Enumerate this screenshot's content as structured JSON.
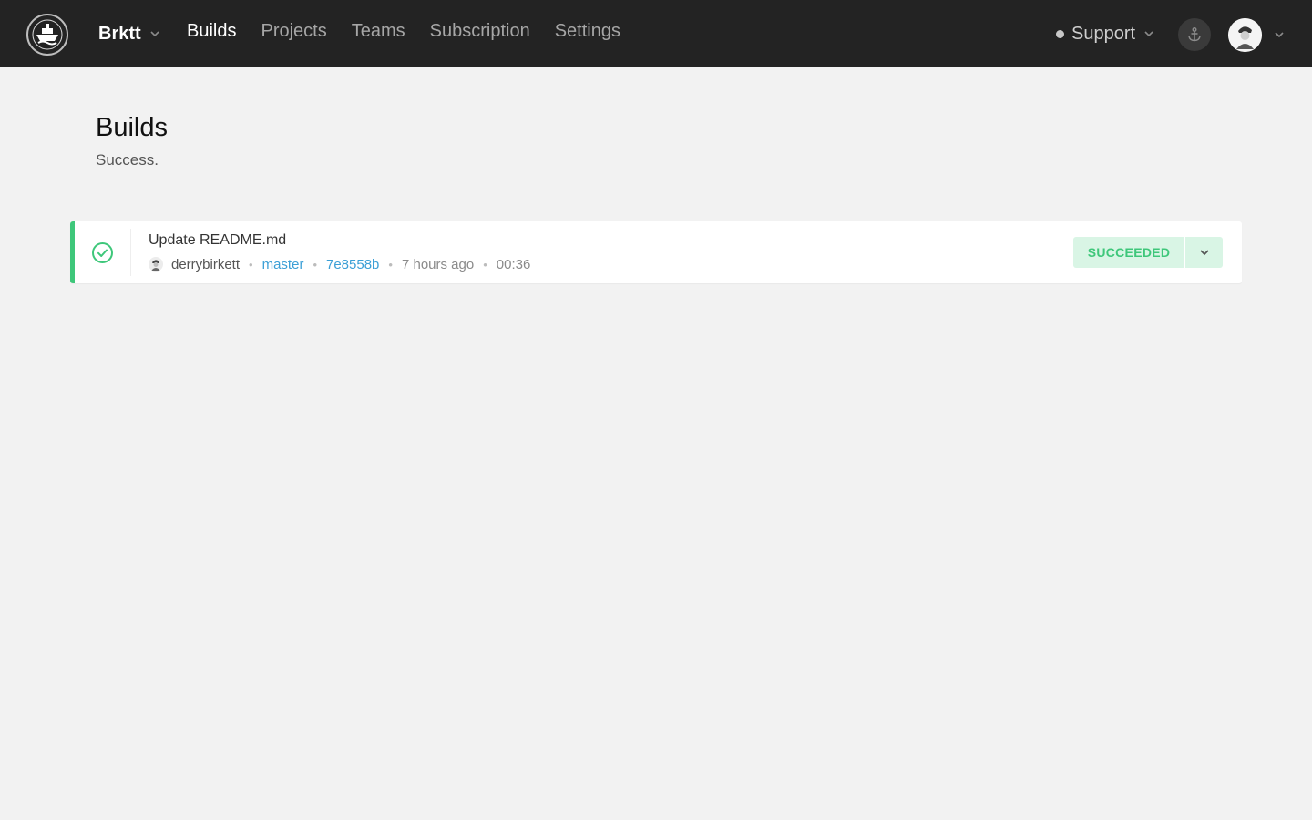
{
  "nav": {
    "team_name": "Brktt",
    "links": [
      {
        "label": "Builds",
        "active": true
      },
      {
        "label": "Projects",
        "active": false
      },
      {
        "label": "Teams",
        "active": false
      },
      {
        "label": "Subscription",
        "active": false
      },
      {
        "label": "Settings",
        "active": false
      }
    ],
    "support_label": "Support",
    "icons": {
      "logo": "ship-logo-icon",
      "anchor": "anchor-icon",
      "avatar": "user-avatar",
      "chevron": "chevron-down-icon"
    }
  },
  "page": {
    "title": "Builds",
    "subtitle": "Success."
  },
  "builds": [
    {
      "commit_message": "Update README.md",
      "author": "derrybirkett",
      "branch": "master",
      "sha": "7e8558b",
      "time_ago": "7 hours ago",
      "duration": "00:36",
      "status": "SUCCEEDED",
      "status_icon": "check-circle-icon"
    }
  ],
  "colors": {
    "navbar_bg": "#232323",
    "page_bg": "#f2f2f2",
    "success": "#3ec77a",
    "success_bg": "#d9f5e5",
    "link": "#3b9fd6"
  }
}
